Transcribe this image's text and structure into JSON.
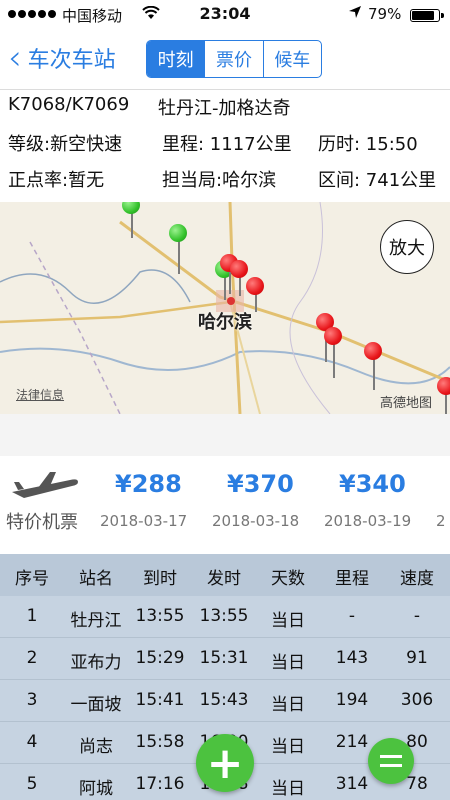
{
  "status_bar": {
    "carrier": "中国移动",
    "time": "23:04",
    "battery": "79%"
  },
  "nav": {
    "back_label": "车次车站",
    "tabs": [
      {
        "label": "时刻"
      },
      {
        "label": "票价"
      },
      {
        "label": "候车"
      }
    ]
  },
  "train": {
    "number": "K7068/K7069",
    "route": "牡丹江-加格达奇",
    "grade": "等级:新空快速",
    "distance": "里程: 1117公里",
    "duration": "历时: 15:50",
    "punctuality": "正点率:暂无",
    "bureau": "担当局:哈尔滨",
    "section": "区间: 741公里"
  },
  "map": {
    "city_label": "哈尔滨",
    "legal_label": "法律信息",
    "provider": "高德地图",
    "zoom_label": "放大"
  },
  "flights": {
    "label": "特价机票",
    "items": [
      {
        "price": "¥288",
        "date": "2018-03-17"
      },
      {
        "price": "¥370",
        "date": "2018-03-18"
      },
      {
        "price": "¥340",
        "date": "2018-03-19"
      }
    ]
  },
  "table": {
    "headers": [
      "序号",
      "站名",
      "到时",
      "发时",
      "天数",
      "里程",
      "速度"
    ],
    "rows": [
      [
        "1",
        "牡丹江",
        "13:55",
        "13:55",
        "当日",
        "-",
        "-"
      ],
      [
        "2",
        "亚布力",
        "15:29",
        "15:31",
        "当日",
        "143",
        "91"
      ],
      [
        "3",
        "一面坡",
        "15:41",
        "15:43",
        "当日",
        "194",
        "306"
      ],
      [
        "4",
        "尚志",
        "15:58",
        "16:00",
        "当日",
        "214",
        "80"
      ],
      [
        "5",
        "阿城",
        "17:16",
        "17:18",
        "当日",
        "314",
        "78"
      ]
    ]
  },
  "colors": {
    "accent": "#2a7de1",
    "green": "#4cc23f",
    "table_header": "#b9c8d8",
    "table_body": "#c6d3e1"
  }
}
